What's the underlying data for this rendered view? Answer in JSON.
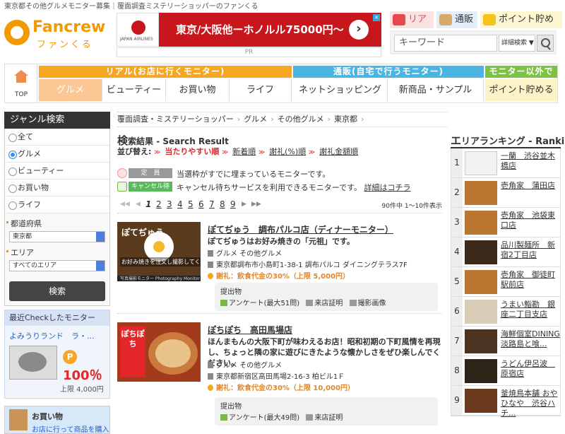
{
  "header": {
    "topline": "東京都その他グルメモニター募集｜覆面調査ミステリーショッパーのファンくる",
    "logo_text": "Fancrew",
    "logo_kana": "ファンくる",
    "ad_text": "東京/大阪他ーホノルル75000円〜",
    "ad_logo_text": "JAPAN AIRLINES",
    "ad_arrow": "›",
    "ad_close": "✕",
    "pr": "PR",
    "right_tabs": [
      "リアル",
      "通販",
      "ポイント貯める"
    ],
    "search_placeholder": "キーワード",
    "search_select": "詳細検索 ▼"
  },
  "gnav": {
    "top_label": "TOP",
    "categories": [
      "リアル(お店に行くモニター)",
      "通販(自宅で行うモニター)",
      "モニター以外で"
    ],
    "items": [
      "グルメ",
      "ビューティー",
      "お買い物",
      "ライフ",
      "ネットショッピング",
      "新商品・サンプル",
      "ポイント貯める"
    ]
  },
  "sidebar": {
    "title": "ジャンル検索",
    "genres": [
      "全て",
      "グルメ",
      "ビューティー",
      "お買い物",
      "ライフ"
    ],
    "selected_genre": "グルメ",
    "pref_label": "都道府県",
    "pref_value": "東京都",
    "area_label": "エリア",
    "area_value": "すべてのエリア",
    "search_button": "検索",
    "recent_title": "最近Checkしたモニター",
    "recent_name": "よみうりランド　ラ・...",
    "recent_p": "P",
    "recent_pct": "100％",
    "recent_limit": "上限 4,000円",
    "shop_title": "お買い物",
    "shop_sub": "お店に行って商品を購入"
  },
  "main": {
    "breadcrumb": [
      "覆面調査・ミステリーショッパー",
      "グルメ",
      "その他グルメ",
      "東京都"
    ],
    "results_big": "検",
    "results_title": "索結果 - Search Result",
    "sort_label": "並び替え:",
    "sort_options": [
      "当たりやすい順",
      "新着順",
      "謝礼(%)順",
      "謝礼金額順"
    ],
    "legend": [
      {
        "badge": "定　員",
        "text": "当選枠がすでに埋まっているモニターです。"
      },
      {
        "badge": "キャンセル待ち",
        "text": "キャンセル待ちサービスを利用できるモニターです。",
        "link": "詳細はコチラ"
      }
    ],
    "pages": [
      "1",
      "2",
      "3",
      "4",
      "5",
      "6",
      "7",
      "8",
      "9"
    ],
    "current_page": "1",
    "count_text": "90件中 1〜10件表示",
    "items": [
      {
        "title": "ぽてぢゅう　調布パルコ店（ディナーモニター）",
        "desc": "ぽてぢゅうはお好み焼きの「元祖」です。",
        "genre": "グルメ その他グルメ",
        "address": "東京都調布市小島町1-38-1 調布パルコ ダイニングテラス7F",
        "reward": "謝礼：飲食代金の30%（上限 5,000円）",
        "submit_label": "提出物",
        "submits": [
          "アンケート(最大51問)",
          "来店証明",
          "撮影画像"
        ],
        "thumb_text": "ぽてぢゅう",
        "thumb_caption": "お好み焼きを注文し撮影してください。",
        "thumb_footer": "写真撮影モニター  Photography Monitor"
      },
      {
        "title": "ぽちぽち　高田馬場店",
        "desc": "ほんまもんの大阪下町が味わえるお店！昭和初期の下町風情を再現し、ちょっと隣の家に遊びにきたような懐かしさをぜひ楽しんでください。",
        "genre": "グルメ その他グルメ",
        "address": "東京都新宿区高田馬場2-16-3 柏ビル1Ｆ",
        "reward": "謝礼：飲食代金の30%（上限 10,000円）",
        "submit_label": "提出物",
        "submits": [
          "アンケート(最大49問)",
          "来店証明"
        ],
        "thumb_text": "ぽちぽち"
      }
    ]
  },
  "ranking": {
    "title_big": "エ",
    "title": "リアランキング - Ranking",
    "items": [
      {
        "num": "1",
        "name": "一蘭　渋谷並木橋店"
      },
      {
        "num": "2",
        "name": "壱角家　蒲田店"
      },
      {
        "num": "3",
        "name": "壱角家　池袋東口店"
      },
      {
        "num": "4",
        "name": "品川製麺所　新宿2丁目店"
      },
      {
        "num": "5",
        "name": "壱角家　御徒町駅前店"
      },
      {
        "num": "6",
        "name": "うまい鮨勘　銀座二丁目支店"
      },
      {
        "num": "7",
        "name": "海鮮個室DINING 淡路島と喰..."
      },
      {
        "num": "8",
        "name": "うどん伊呂波　原宿店"
      },
      {
        "num": "9",
        "name": "釜焼鳥本舗 おやひなや　渋谷ハチ..."
      }
    ]
  },
  "colors": {
    "brand_orange": "#f39800",
    "real_orange": "#f6a623",
    "online_blue": "#4ab5e3",
    "other_green": "#7dc242",
    "accent_red": "#e3262a"
  }
}
